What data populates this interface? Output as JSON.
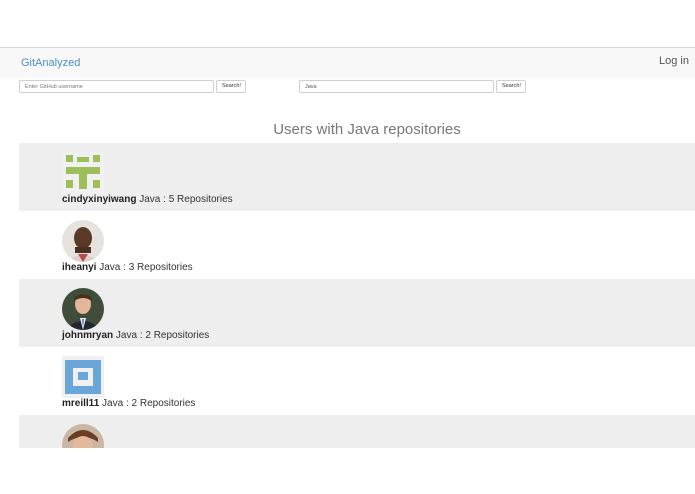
{
  "navbar": {
    "brand": "GitAnalyzed",
    "login_label": "Log in"
  },
  "search": {
    "username_placeholder": "Enter GitHub username",
    "username_button": "Search!",
    "language_value": "Java",
    "language_button": "Search!"
  },
  "heading": "Users with Java repositories",
  "users": [
    {
      "username": "cindyxinyiwang",
      "language": "Java",
      "repos_text": ": 5 Repositories",
      "avatar": "identicon-green"
    },
    {
      "username": "iheanyi",
      "language": "Java",
      "repos_text": ": 3 Repositories",
      "avatar": "photo-man"
    },
    {
      "username": "johnmryan",
      "language": "Java",
      "repos_text": ": 2 Repositories",
      "avatar": "photo-suit"
    },
    {
      "username": "mreill11",
      "language": "Java",
      "repos_text": ": 2 Repositories",
      "avatar": "identicon-blue"
    },
    {
      "username": "",
      "language": "",
      "repos_text": "",
      "avatar": "photo-partial"
    }
  ],
  "colors": {
    "brand": "#4a8fcf",
    "row_shade": "#eeeeee",
    "identicon_green": "#9cbf5a",
    "identicon_blue": "#6aa6d9"
  }
}
